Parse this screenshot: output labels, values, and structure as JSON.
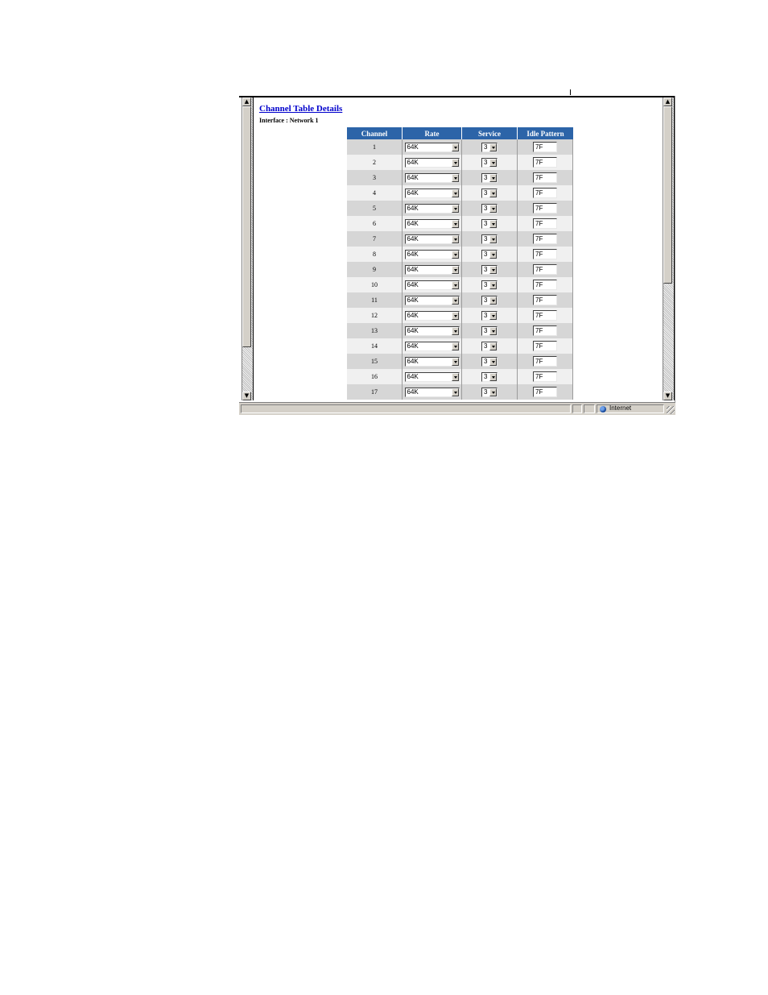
{
  "page": {
    "title": "Channel Table Details",
    "subtitle": "Interface : Network 1"
  },
  "table": {
    "headers": [
      "Channel",
      "Rate",
      "Service",
      "Idle Pattern"
    ],
    "rows": [
      {
        "channel": "1",
        "rate": "64K",
        "service": "3",
        "idle": "7F"
      },
      {
        "channel": "2",
        "rate": "64K",
        "service": "3",
        "idle": "7F"
      },
      {
        "channel": "3",
        "rate": "64K",
        "service": "3",
        "idle": "7F"
      },
      {
        "channel": "4",
        "rate": "64K",
        "service": "3",
        "idle": "7F"
      },
      {
        "channel": "5",
        "rate": "64K",
        "service": "3",
        "idle": "7F"
      },
      {
        "channel": "6",
        "rate": "64K",
        "service": "3",
        "idle": "7F"
      },
      {
        "channel": "7",
        "rate": "64K",
        "service": "3",
        "idle": "7F"
      },
      {
        "channel": "8",
        "rate": "64K",
        "service": "3",
        "idle": "7F"
      },
      {
        "channel": "9",
        "rate": "64K",
        "service": "3",
        "idle": "7F"
      },
      {
        "channel": "10",
        "rate": "64K",
        "service": "3",
        "idle": "7F"
      },
      {
        "channel": "11",
        "rate": "64K",
        "service": "3",
        "idle": "7F"
      },
      {
        "channel": "12",
        "rate": "64K",
        "service": "3",
        "idle": "7F"
      },
      {
        "channel": "13",
        "rate": "64K",
        "service": "3",
        "idle": "7F"
      },
      {
        "channel": "14",
        "rate": "64K",
        "service": "3",
        "idle": "7F"
      },
      {
        "channel": "15",
        "rate": "64K",
        "service": "3",
        "idle": "7F"
      },
      {
        "channel": "16",
        "rate": "64K",
        "service": "3",
        "idle": "7F"
      },
      {
        "channel": "17",
        "rate": "64K",
        "service": "3",
        "idle": "7F"
      }
    ]
  },
  "statusbar": {
    "zone_label": "Internet",
    "zone_icon": "globe-icon"
  },
  "colors": {
    "header_bg": "#2c64a8",
    "title_link": "#0000cc",
    "row_odd": "#d6d6d6",
    "row_even": "#f0f0f0"
  }
}
